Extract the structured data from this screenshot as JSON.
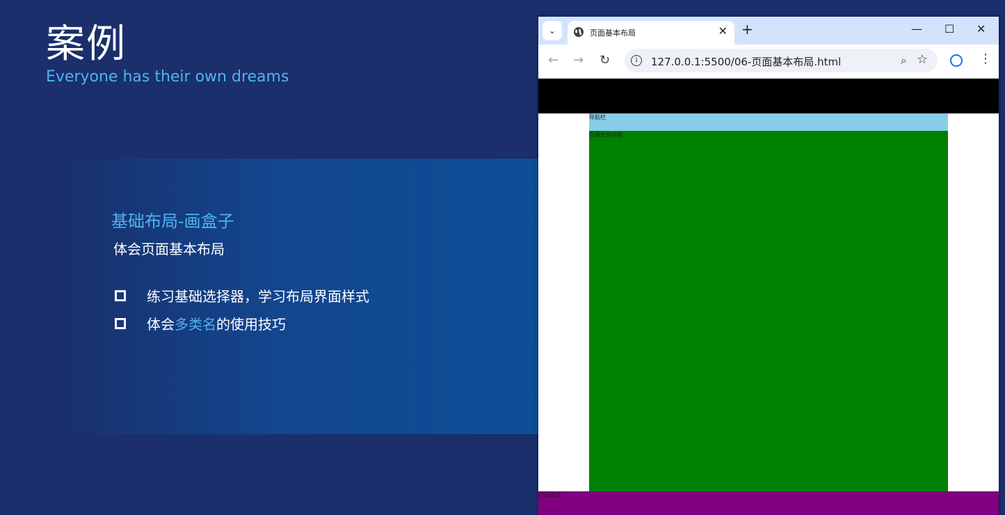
{
  "slide": {
    "title": "案例",
    "subtitle": "Everyone has their own dreams",
    "panel_heading": "基础布局-画盒子",
    "panel_subheading": "体会页面基本布局",
    "bullet1": "练习基础选择器，学习布局界面样式",
    "bullet2_pre": "体会",
    "bullet2_highlight": "多类名",
    "bullet2_post": "的使用技巧"
  },
  "browser": {
    "tab_title": "页面基本布局",
    "url": "127.0.0.1:5500/06-页面基本布局.html",
    "page": {
      "nav_text": "导航栏",
      "main_text": "页面主体内容",
      "footer_text": "页面底部"
    }
  },
  "colors": {
    "background": "#1a2f6b",
    "accent": "#4fb4ef",
    "header": "#000000",
    "nav": "#87ceeb",
    "main": "#008000",
    "footer": "#800080"
  },
  "icons": [
    "tab-list-icon",
    "globe-icon",
    "close-icon",
    "plus-icon",
    "minimize-icon",
    "maximize-icon",
    "window-close-icon",
    "back-icon",
    "forward-icon",
    "reload-icon",
    "info-icon",
    "zoom-icon",
    "star-icon",
    "profile-icon",
    "menu-icon",
    "checkbox-icon"
  ]
}
